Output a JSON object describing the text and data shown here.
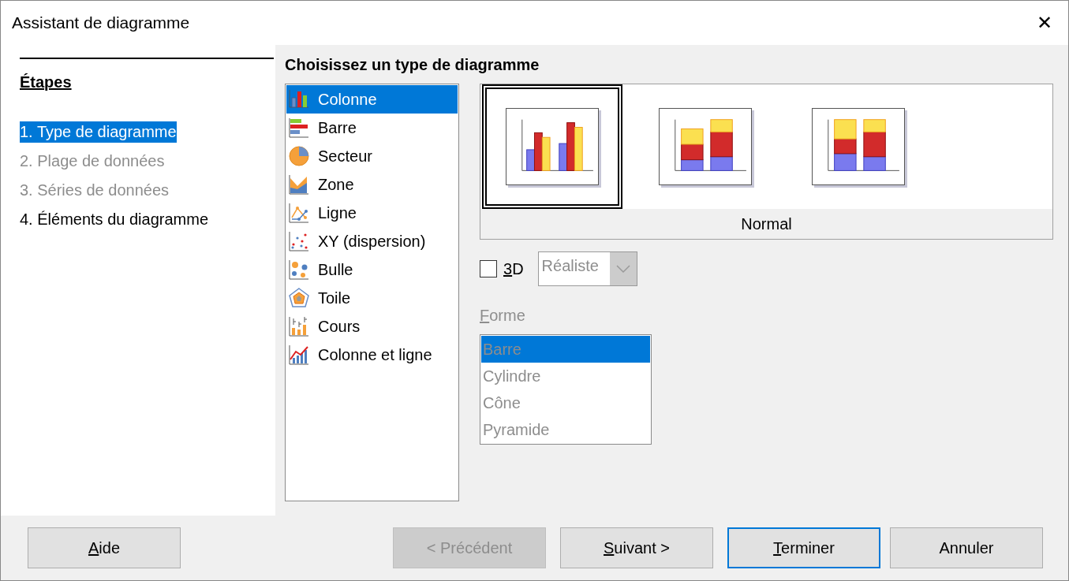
{
  "window": {
    "title": "Assistant de diagramme",
    "close": "✕"
  },
  "steps": {
    "heading": "Étapes",
    "items": [
      {
        "label": "1. Type de diagramme",
        "selected": true,
        "disabled": false
      },
      {
        "label": "2. Plage de données",
        "selected": false,
        "disabled": true
      },
      {
        "label": "3. Séries de données",
        "selected": false,
        "disabled": true
      },
      {
        "label": "4. Éléments du diagramme",
        "selected": false,
        "disabled": false
      }
    ]
  },
  "section_title": "Choisissez un type de diagramme",
  "chart_types": [
    {
      "label": "Colonne",
      "selected": true
    },
    {
      "label": "Barre",
      "selected": false
    },
    {
      "label": "Secteur",
      "selected": false
    },
    {
      "label": "Zone",
      "selected": false
    },
    {
      "label": "Ligne",
      "selected": false
    },
    {
      "label": "XY (dispersion)",
      "selected": false
    },
    {
      "label": "Bulle",
      "selected": false
    },
    {
      "label": "Toile",
      "selected": false
    },
    {
      "label": "Cours",
      "selected": false
    },
    {
      "label": "Colonne et ligne",
      "selected": false
    }
  ],
  "variants": {
    "items": [
      {
        "kind": "clustered",
        "selected": true
      },
      {
        "kind": "stacked",
        "selected": false
      },
      {
        "kind": "percent",
        "selected": false
      }
    ],
    "caption": "Normal"
  },
  "three_d": {
    "label": "3D",
    "underline_first": true,
    "checked": false
  },
  "style_dropdown": {
    "value": "Réaliste",
    "disabled": true
  },
  "shape": {
    "label": "Forme",
    "underline_first": true,
    "disabled": true,
    "items": [
      {
        "label": "Barre",
        "selected": true
      },
      {
        "label": "Cylindre",
        "selected": false
      },
      {
        "label": "Cône",
        "selected": false
      },
      {
        "label": "Pyramide",
        "selected": false
      }
    ]
  },
  "buttons": [
    {
      "label": "Aide",
      "underline_first": true,
      "disabled": false,
      "default": false
    },
    {
      "label": "< Précédent",
      "underline_first": false,
      "disabled": true,
      "default": false
    },
    {
      "label": "Suivant >",
      "underline_first": true,
      "disabled": false,
      "default": false
    },
    {
      "label": "Terminer",
      "underline_first": true,
      "disabled": false,
      "default": true
    },
    {
      "label": "Annuler",
      "underline_first": false,
      "disabled": false,
      "default": false
    }
  ]
}
